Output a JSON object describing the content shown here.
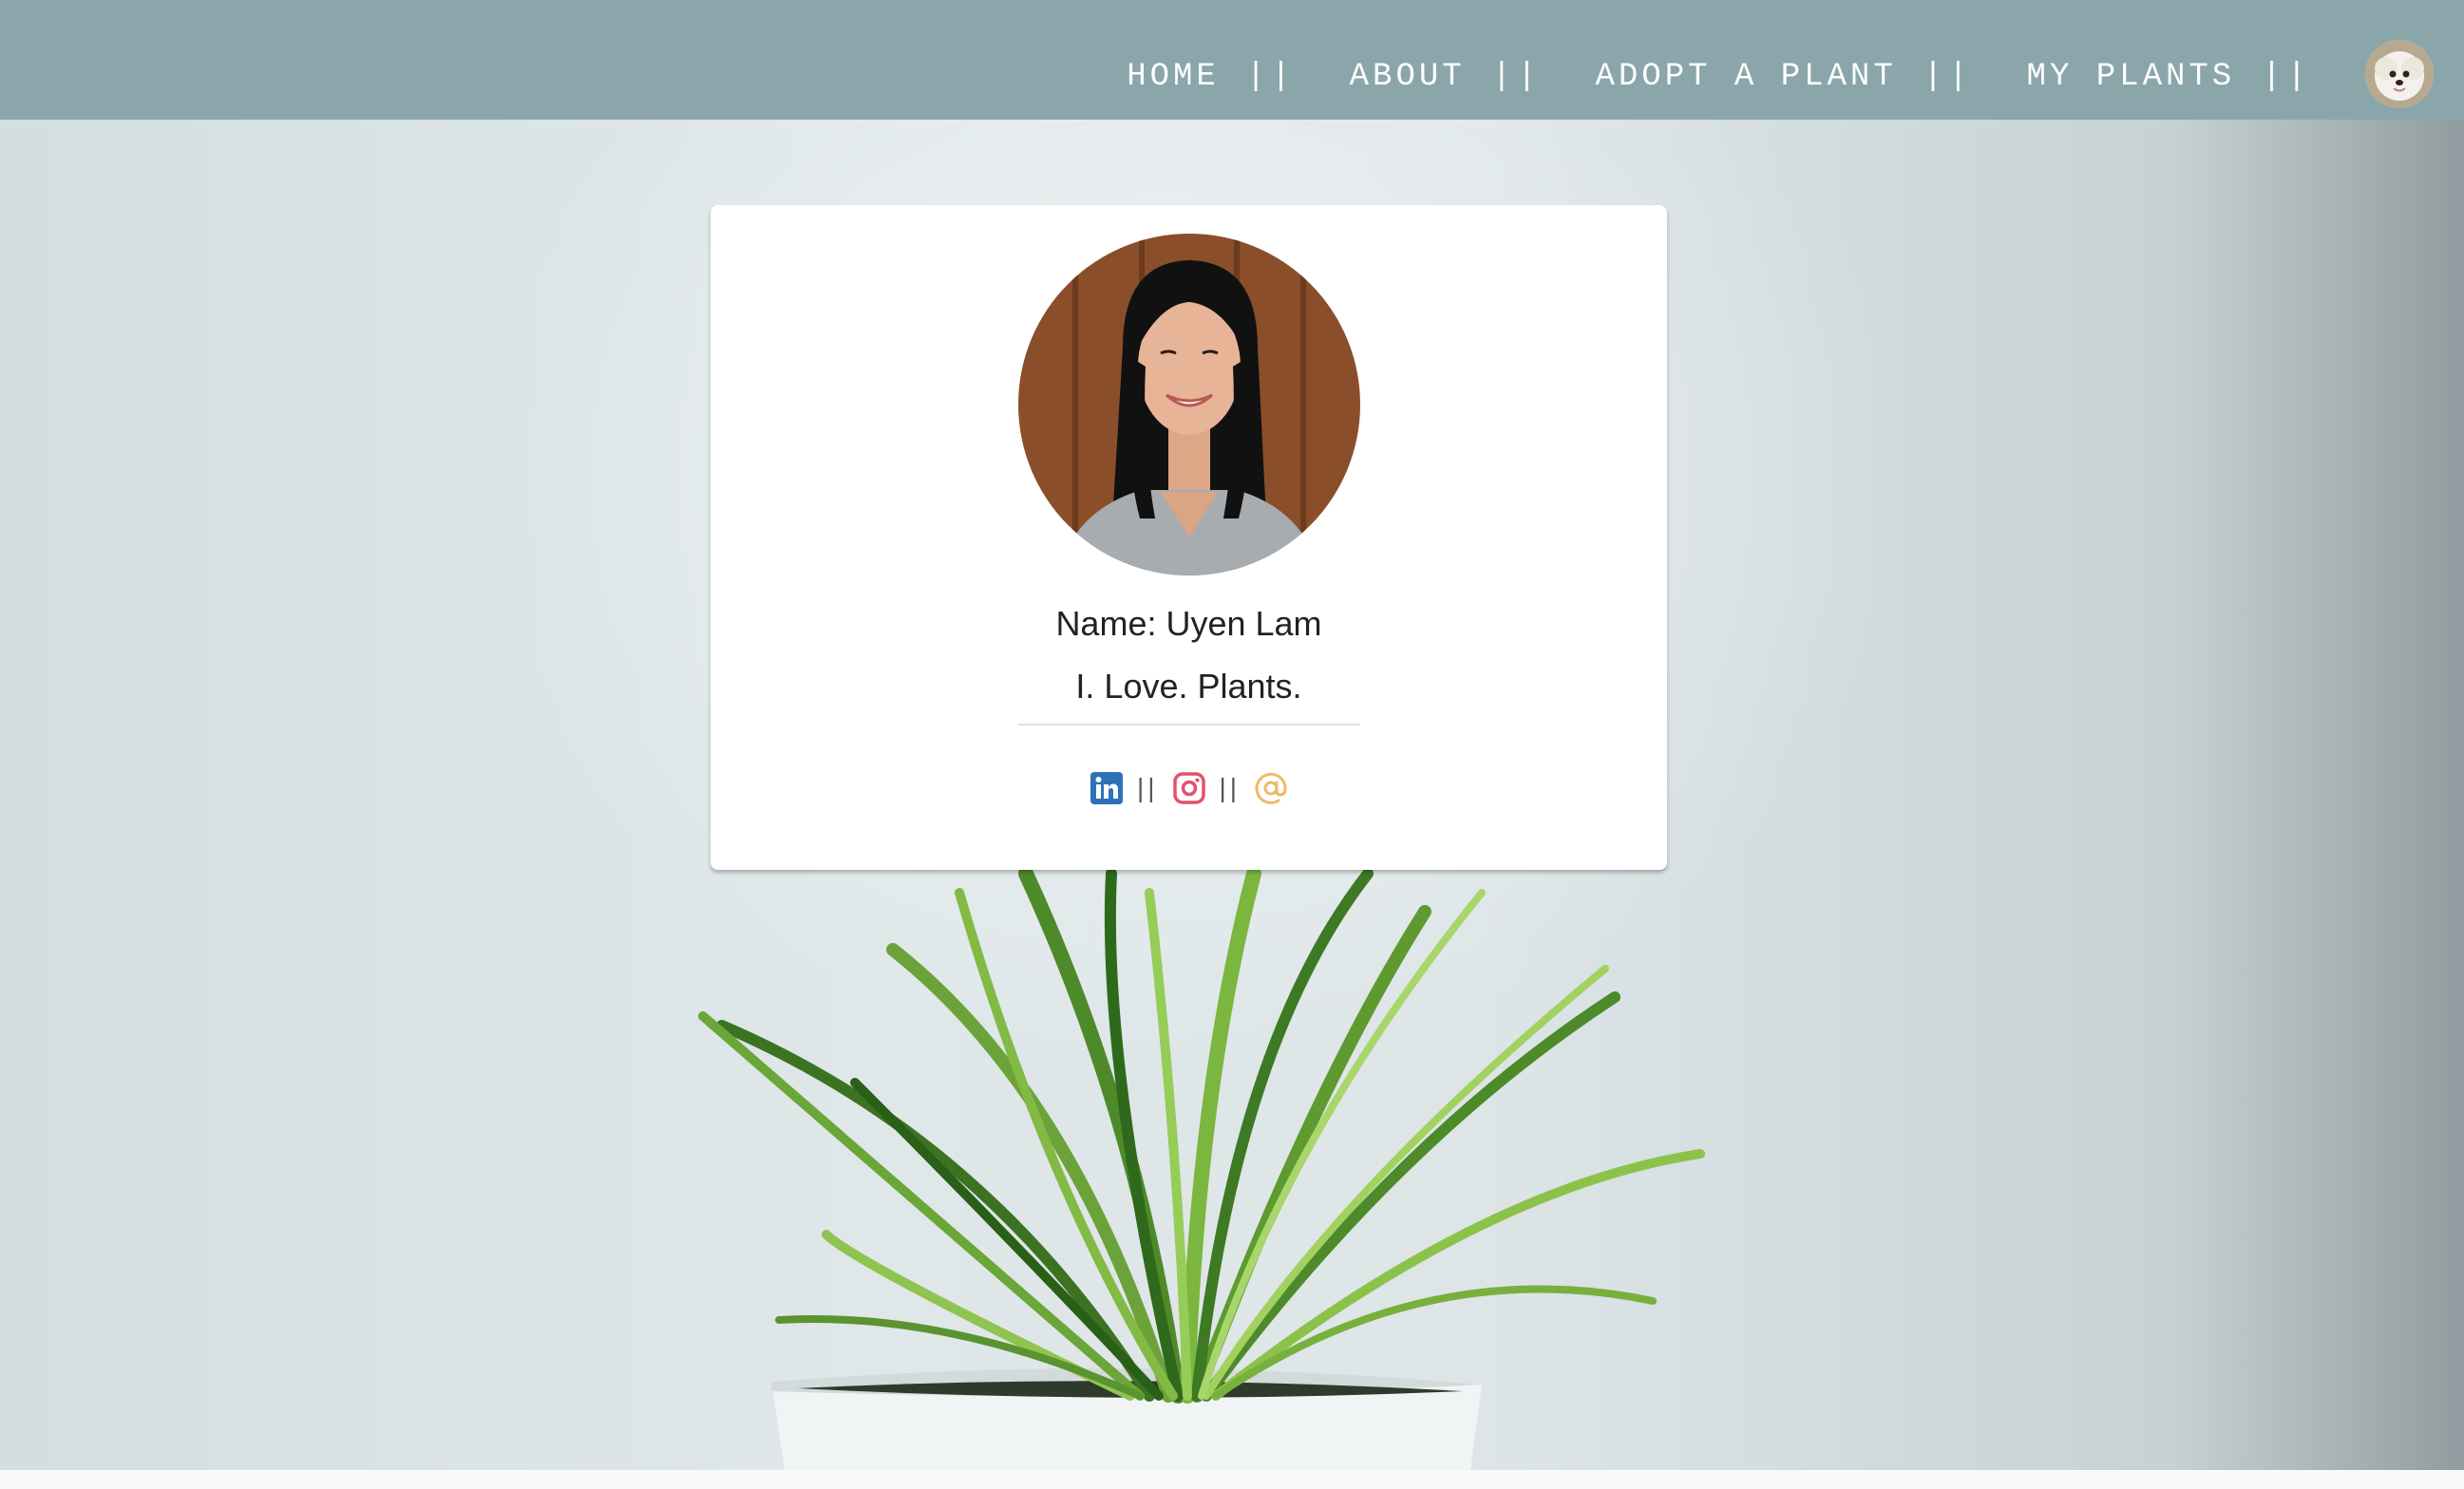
{
  "nav": {
    "items": [
      {
        "label": "HOME",
        "sep": "||"
      },
      {
        "label": "ABOUT",
        "sep": "||"
      },
      {
        "label": "ADOPT A PLANT",
        "sep": "||"
      },
      {
        "label": "MY PLANTS",
        "sep": "||"
      }
    ],
    "avatar_icon": "user-avatar-icon"
  },
  "profile": {
    "name": "Name: Uyen Lam",
    "tagline": "I. Love. Plants.",
    "social": [
      {
        "icon": "linkedin-icon",
        "color": "#2d72b8"
      },
      {
        "sep": "||"
      },
      {
        "icon": "instagram-icon",
        "color": "#e1526b"
      },
      {
        "sep": "||"
      },
      {
        "icon": "email-at-icon",
        "color": "#f0b968"
      }
    ]
  },
  "colors": {
    "navbar": "#8ba6ab",
    "card": "#ffffff",
    "text": "#222222"
  }
}
